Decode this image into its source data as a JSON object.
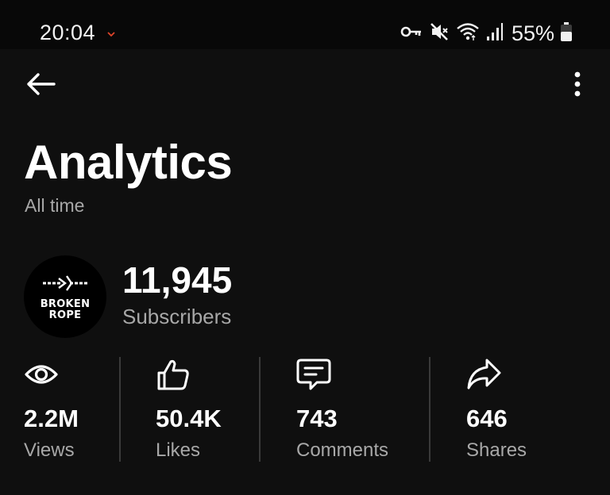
{
  "status_bar": {
    "time": "20:04",
    "battery": "55%",
    "icons": [
      "notification-chevron-icon",
      "vpn-key-icon",
      "mute-icon",
      "wifi-icon",
      "cell-signal-icon",
      "battery-icon"
    ]
  },
  "header": {
    "back_icon": "arrow-left-icon",
    "more_icon": "more-vertical-icon"
  },
  "page": {
    "title": "Analytics",
    "subtitle": "All time"
  },
  "channel": {
    "avatar_text": "BROKEN\nROPE",
    "subscriber_count": "11,945",
    "subscriber_label": "Subscribers"
  },
  "stats": [
    {
      "icon": "eye-icon",
      "value": "2.2M",
      "label": "Views"
    },
    {
      "icon": "thumbs-up-icon",
      "value": "50.4K",
      "label": "Likes"
    },
    {
      "icon": "comment-icon",
      "value": "743",
      "label": "Comments"
    },
    {
      "icon": "share-icon",
      "value": "646",
      "label": "Shares"
    }
  ],
  "colors": {
    "background": "#0f0f0f",
    "status_bar_bg": "#080808",
    "text_primary": "#ffffff",
    "text_secondary": "#a8a8a8",
    "divider": "#3a3a3a",
    "notification_accent": "#e0452b"
  }
}
